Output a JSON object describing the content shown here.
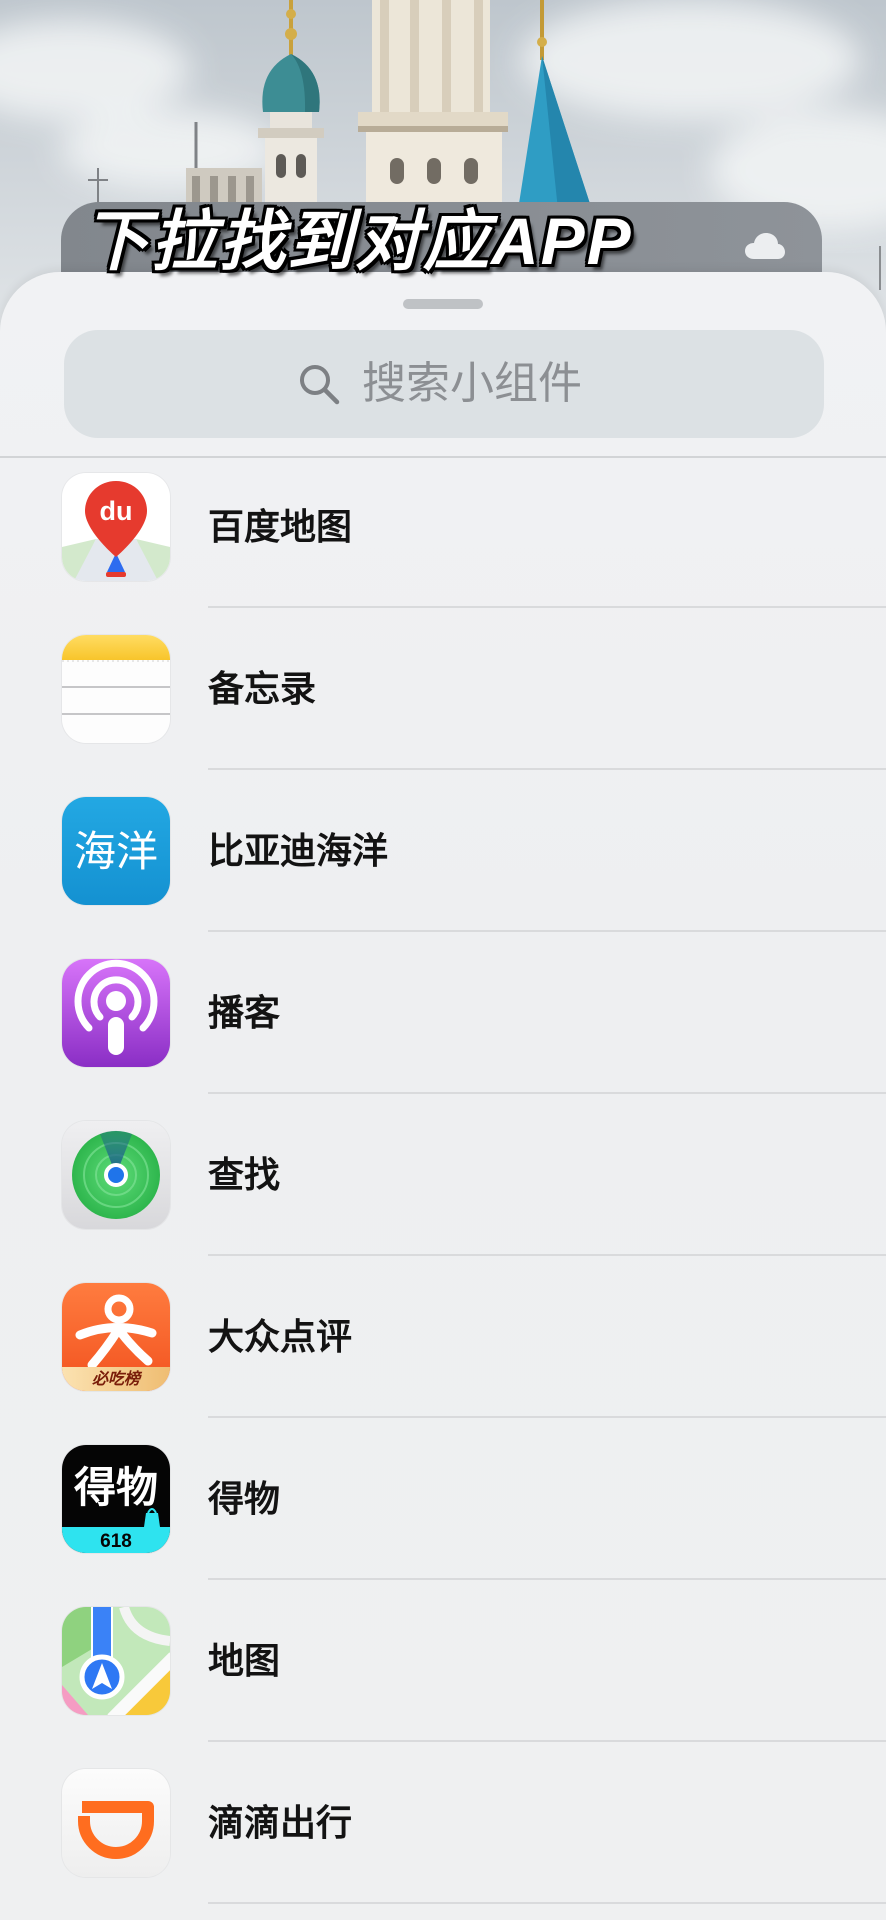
{
  "caption": "下拉找到对应APP",
  "widget": {
    "weather_icon": "cloud-icon"
  },
  "search": {
    "placeholder": "搜索小组件",
    "icon": "search-icon"
  },
  "apps": [
    {
      "name": "百度地图",
      "icon": "baidu-maps-icon",
      "icon_text": "du"
    },
    {
      "name": "备忘录",
      "icon": "notes-icon"
    },
    {
      "name": "比亚迪海洋",
      "icon": "byd-ocean-icon",
      "icon_text": "海洋"
    },
    {
      "name": "播客",
      "icon": "podcasts-icon"
    },
    {
      "name": "查找",
      "icon": "find-my-icon"
    },
    {
      "name": "大众点评",
      "icon": "dianping-icon",
      "icon_text": "必吃榜"
    },
    {
      "name": "得物",
      "icon": "dewu-icon",
      "icon_text": "得物",
      "icon_badge": "618"
    },
    {
      "name": "地图",
      "icon": "apple-maps-icon"
    },
    {
      "name": "滴滴出行",
      "icon": "didi-icon"
    }
  ],
  "colors": {
    "sheet_background": "#eff0f2",
    "search_field": "#dce1e4",
    "label_text": "#131313",
    "placeholder_text": "#8c8f93"
  }
}
